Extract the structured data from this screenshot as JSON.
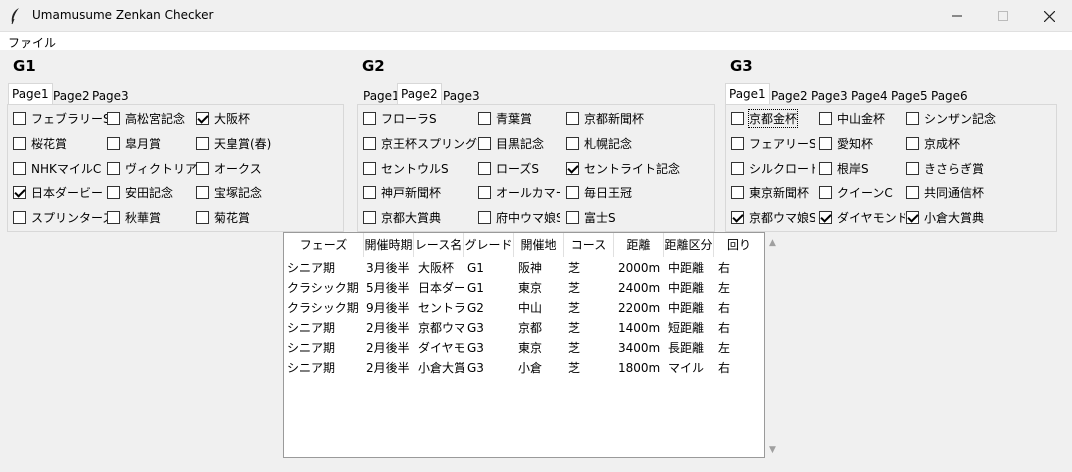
{
  "window": {
    "title": "Umamusume Zenkan Checker"
  },
  "menu": {
    "file": "ファイル"
  },
  "g1": {
    "title": "G1",
    "tabs": [
      "Page1",
      "Page2",
      "Page3"
    ],
    "active_tab": 0,
    "items": [
      {
        "label": "フェブラリーS",
        "checked": false
      },
      {
        "label": "高松宮記念",
        "checked": false
      },
      {
        "label": "大阪杯",
        "checked": true
      },
      {
        "label": "桜花賞",
        "checked": false
      },
      {
        "label": "皐月賞",
        "checked": false
      },
      {
        "label": "天皇賞(春)",
        "checked": false
      },
      {
        "label": "NHKマイルC",
        "checked": false
      },
      {
        "label": "ヴィクトリアM",
        "checked": false
      },
      {
        "label": "オークス",
        "checked": false
      },
      {
        "label": "日本ダービー",
        "checked": true
      },
      {
        "label": "安田記念",
        "checked": false
      },
      {
        "label": "宝塚記念",
        "checked": false
      },
      {
        "label": "スプリンターズS",
        "checked": false
      },
      {
        "label": "秋華賞",
        "checked": false
      },
      {
        "label": "菊花賞",
        "checked": false
      }
    ]
  },
  "g2": {
    "title": "G2",
    "tabs": [
      "Page1",
      "Page2",
      "Page3"
    ],
    "active_tab": 1,
    "items": [
      {
        "label": "フローラS",
        "checked": false
      },
      {
        "label": "青葉賞",
        "checked": false
      },
      {
        "label": "京都新聞杯",
        "checked": false
      },
      {
        "label": "京王杯スプリングC",
        "checked": false
      },
      {
        "label": "目黒記念",
        "checked": false
      },
      {
        "label": "札幌記念",
        "checked": false
      },
      {
        "label": "セントウルS",
        "checked": false
      },
      {
        "label": "ローズS",
        "checked": false
      },
      {
        "label": "セントライト記念",
        "checked": true
      },
      {
        "label": "神戸新聞杯",
        "checked": false
      },
      {
        "label": "オールカマー",
        "checked": false
      },
      {
        "label": "毎日王冠",
        "checked": false
      },
      {
        "label": "京都大賞典",
        "checked": false
      },
      {
        "label": "府中ウマ娘S",
        "checked": false
      },
      {
        "label": "富士S",
        "checked": false
      }
    ]
  },
  "g3": {
    "title": "G3",
    "tabs": [
      "Page1",
      "Page2",
      "Page3",
      "Page4",
      "Page5",
      "Page6"
    ],
    "active_tab": 0,
    "items": [
      {
        "label": "京都金杯",
        "checked": false
      },
      {
        "label": "中山金杯",
        "checked": false
      },
      {
        "label": "シンザン記念",
        "checked": false
      },
      {
        "label": "フェアリーS",
        "checked": false
      },
      {
        "label": "愛知杯",
        "checked": false
      },
      {
        "label": "京成杯",
        "checked": false
      },
      {
        "label": "シルクロードS",
        "checked": false
      },
      {
        "label": "根岸S",
        "checked": false
      },
      {
        "label": "きさらぎ賞",
        "checked": false
      },
      {
        "label": "東京新聞杯",
        "checked": false
      },
      {
        "label": "クイーンC",
        "checked": false
      },
      {
        "label": "共同通信杯",
        "checked": false
      },
      {
        "label": "京都ウマ娘S",
        "checked": true
      },
      {
        "label": "ダイヤモンドS",
        "checked": true
      },
      {
        "label": "小倉大賞典",
        "checked": true
      }
    ]
  },
  "table": {
    "columns": [
      "フェーズ",
      "開催時期",
      "レース名",
      "グレード",
      "開催地",
      "コース",
      "距離",
      "距離区分",
      "回り"
    ],
    "rows": [
      [
        "シニア期",
        "3月後半",
        "大阪杯",
        "G1",
        "阪神",
        "芝",
        "2000m",
        "中距離",
        "右"
      ],
      [
        "クラシック期",
        "5月後半",
        "日本ダービー",
        "G1",
        "東京",
        "芝",
        "2400m",
        "中距離",
        "左"
      ],
      [
        "クラシック期",
        "9月後半",
        "セントライト記念",
        "G2",
        "中山",
        "芝",
        "2200m",
        "中距離",
        "右"
      ],
      [
        "シニア期",
        "2月後半",
        "京都ウマ娘S",
        "G3",
        "京都",
        "芝",
        "1400m",
        "短距離",
        "右"
      ],
      [
        "シニア期",
        "2月後半",
        "ダイヤモンドS",
        "G3",
        "東京",
        "芝",
        "3400m",
        "長距離",
        "左"
      ],
      [
        "シニア期",
        "2月後半",
        "小倉大賞典",
        "G3",
        "小倉",
        "芝",
        "1800m",
        "マイル",
        "右"
      ]
    ]
  }
}
